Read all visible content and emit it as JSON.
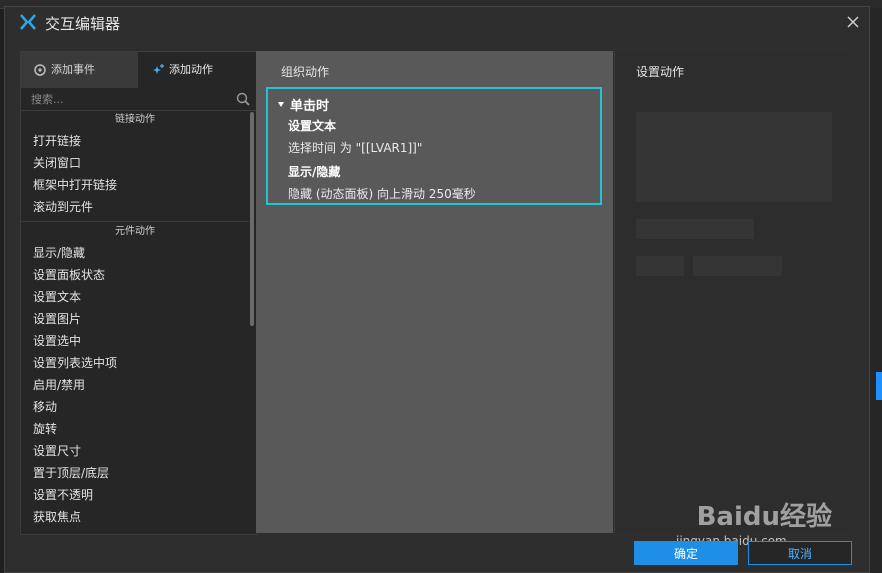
{
  "window": {
    "title": "交互编辑器"
  },
  "left_panel": {
    "tabs": [
      {
        "label": "添加事件",
        "icon": "event-icon"
      },
      {
        "label": "添加动作",
        "icon": "sparkle-add-icon"
      }
    ],
    "search": {
      "placeholder": "搜索..."
    },
    "sections": [
      {
        "header": "链接动作",
        "items": [
          "打开链接",
          "关闭窗口",
          "框架中打开链接",
          "滚动到元件"
        ]
      },
      {
        "header": "元件动作",
        "items": [
          "显示/隐藏",
          "设置面板状态",
          "设置文本",
          "设置图片",
          "设置选中",
          "设置列表选中项",
          "启用/禁用",
          "移动",
          "旋转",
          "设置尺寸",
          "置于顶层/底层",
          "设置不透明",
          "获取焦点"
        ]
      }
    ]
  },
  "middle_panel": {
    "title": "组织动作",
    "case": {
      "label": "单击时",
      "actions": [
        {
          "title": "设置文本",
          "desc": "选择时间 为 \"[[LVAR1]]\""
        },
        {
          "title": "显示/隐藏",
          "desc": "隐藏 (动态面板) 向上滑动 250毫秒"
        }
      ]
    }
  },
  "right_panel": {
    "title": "设置动作"
  },
  "footer": {
    "ok_label": "确定",
    "cancel_label": "取消"
  },
  "watermark": {
    "brand": "Baidu经验",
    "url": "jingyan.baidu.com"
  },
  "colors": {
    "accent": "#1e8ee6",
    "case_border": "#21c4d0",
    "logo": "#2aa7e6"
  }
}
